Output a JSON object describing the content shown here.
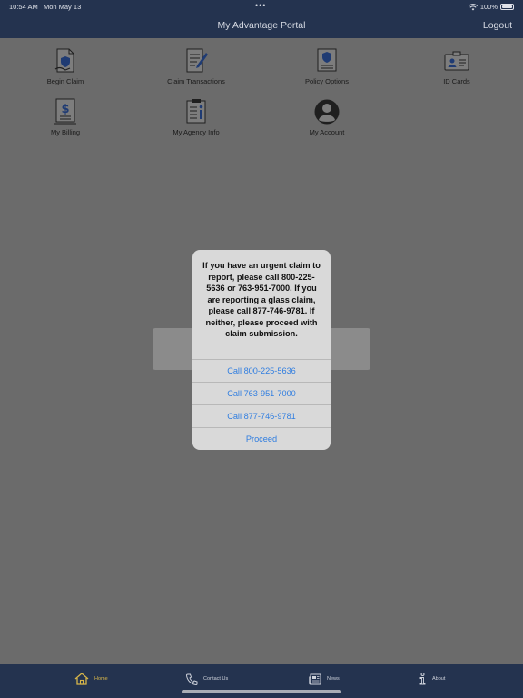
{
  "status_bar": {
    "time": "10:54 AM",
    "date": "Mon May 13",
    "battery": "100%"
  },
  "header": {
    "title": "My Advantage Portal",
    "logout_label": "Logout"
  },
  "menu": {
    "begin_claim": "Begin Claim",
    "claim_transactions": "Claim Transactions",
    "policy_options": "Policy Options",
    "id_cards": "ID Cards",
    "my_billing": "My Billing",
    "my_agency_info": "My Agency Info",
    "my_account": "My Account"
  },
  "alert": {
    "message": "If you have an urgent claim to report, please call 800-225-5636 or 763-951-7000. If you are reporting a glass claim, please call 877-746-9781. If neither, please proceed with claim submission.",
    "buttons": [
      "Call 800-225-5636",
      "Call 763-951-7000",
      "Call 877-746-9781",
      "Proceed"
    ]
  },
  "tabs": {
    "home": "Home",
    "contact_us": "Contact Us",
    "news": "News",
    "about": "About"
  },
  "colors": {
    "nav_bar": "#24334f",
    "icon_blue": "#1f3b73",
    "link_blue": "#2f7de0",
    "active_tab": "#d6b54a"
  }
}
